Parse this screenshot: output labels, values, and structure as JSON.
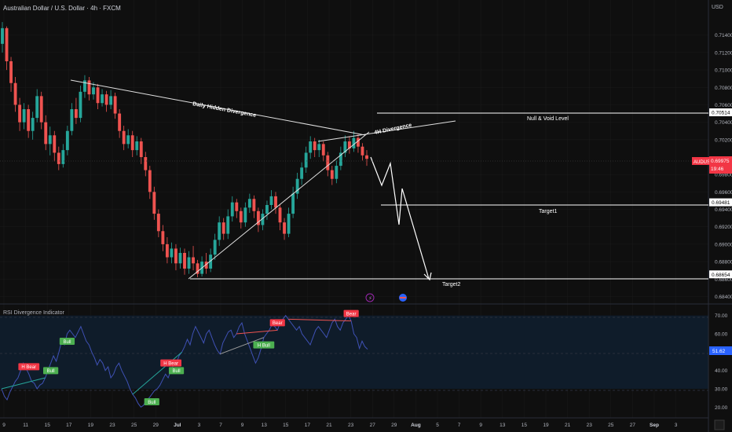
{
  "title": "Australian Dollar / U.S. Dollar · 4h · FXCM",
  "currency_label": "USD",
  "colors": {
    "background": "#0f0f0f",
    "bull": "#26a69a",
    "bear": "#ef5350",
    "grid": "#1c1c1c",
    "text": "#d1d4dc",
    "rsi_line": "#3f51b5",
    "rsi_band": "#0f1c2a",
    "annotation": "#ffffff",
    "price_tag": "#f23645"
  },
  "chart_data": [
    {
      "type": "candlestick",
      "title": "Australian Dollar / U.S. Dollar · 4h · FXCM",
      "ylim": [
        0.6835,
        0.7165
      ],
      "y_ticks": [
        "0.71400",
        "0.71200",
        "0.71000",
        "0.70800",
        "0.70600",
        "0.70400",
        "0.70200",
        "0.69800",
        "0.69600",
        "0.69400",
        "0.69200",
        "0.69000",
        "0.68800",
        "0.68600",
        "0.68400"
      ],
      "x_ticks": [
        "9",
        "11",
        "15",
        "17",
        "19",
        "23",
        "25",
        "29",
        "Jul",
        "3",
        "7",
        "9",
        "13",
        "15",
        "17",
        "21",
        "23",
        "27",
        "29",
        "Aug",
        "5",
        "7",
        "9",
        "13",
        "15",
        "19",
        "21",
        "23",
        "25",
        "27",
        "Sep",
        "3"
      ],
      "candles": [
        {
          "o": 0.713,
          "c": 0.7148,
          "h": 0.7155,
          "l": 0.712
        },
        {
          "o": 0.7148,
          "c": 0.711,
          "h": 0.715,
          "l": 0.71
        },
        {
          "o": 0.711,
          "c": 0.7085,
          "h": 0.7115,
          "l": 0.7075
        },
        {
          "o": 0.7085,
          "c": 0.706,
          "h": 0.7092,
          "l": 0.7052
        },
        {
          "o": 0.706,
          "c": 0.704,
          "h": 0.7068,
          "l": 0.703
        },
        {
          "o": 0.704,
          "c": 0.7055,
          "h": 0.7062,
          "l": 0.7032
        },
        {
          "o": 0.7055,
          "c": 0.703,
          "h": 0.706,
          "l": 0.7022
        },
        {
          "o": 0.703,
          "c": 0.7045,
          "h": 0.7052,
          "l": 0.702
        },
        {
          "o": 0.7045,
          "c": 0.707,
          "h": 0.7078,
          "l": 0.704
        },
        {
          "o": 0.707,
          "c": 0.704,
          "h": 0.7075,
          "l": 0.7032
        },
        {
          "o": 0.704,
          "c": 0.7015,
          "h": 0.7048,
          "l": 0.7008
        },
        {
          "o": 0.7015,
          "c": 0.7025,
          "h": 0.7035,
          "l": 0.7002
        },
        {
          "o": 0.7025,
          "c": 0.7005,
          "h": 0.703,
          "l": 0.6995
        },
        {
          "o": 0.7005,
          "c": 0.6992,
          "h": 0.7012,
          "l": 0.6985
        },
        {
          "o": 0.6992,
          "c": 0.7008,
          "h": 0.7015,
          "l": 0.6988
        },
        {
          "o": 0.7008,
          "c": 0.703,
          "h": 0.7036,
          "l": 0.7002
        },
        {
          "o": 0.703,
          "c": 0.7055,
          "h": 0.7062,
          "l": 0.7025
        },
        {
          "o": 0.7055,
          "c": 0.7045,
          "h": 0.7068,
          "l": 0.7038
        },
        {
          "o": 0.7045,
          "c": 0.7075,
          "h": 0.7082,
          "l": 0.704
        },
        {
          "o": 0.7075,
          "c": 0.7088,
          "h": 0.7094,
          "l": 0.7068
        },
        {
          "o": 0.7088,
          "c": 0.7072,
          "h": 0.7092,
          "l": 0.7065
        },
        {
          "o": 0.7072,
          "c": 0.708,
          "h": 0.7086,
          "l": 0.7066
        },
        {
          "o": 0.708,
          "c": 0.7062,
          "h": 0.7084,
          "l": 0.7055
        },
        {
          "o": 0.7062,
          "c": 0.7072,
          "h": 0.7078,
          "l": 0.7058
        },
        {
          "o": 0.7072,
          "c": 0.706,
          "h": 0.7076,
          "l": 0.7052
        },
        {
          "o": 0.706,
          "c": 0.707,
          "h": 0.7077,
          "l": 0.7055
        },
        {
          "o": 0.707,
          "c": 0.705,
          "h": 0.7074,
          "l": 0.7044
        },
        {
          "o": 0.705,
          "c": 0.703,
          "h": 0.7055,
          "l": 0.7022
        },
        {
          "o": 0.703,
          "c": 0.7015,
          "h": 0.7036,
          "l": 0.7008
        },
        {
          "o": 0.7015,
          "c": 0.7025,
          "h": 0.7032,
          "l": 0.701
        },
        {
          "o": 0.7025,
          "c": 0.7008,
          "h": 0.703,
          "l": 0.7
        },
        {
          "o": 0.7008,
          "c": 0.7018,
          "h": 0.7024,
          "l": 0.7002
        },
        {
          "o": 0.7018,
          "c": 0.7,
          "h": 0.7022,
          "l": 0.6992
        },
        {
          "o": 0.7,
          "c": 0.6985,
          "h": 0.7006,
          "l": 0.6978
        },
        {
          "o": 0.6985,
          "c": 0.696,
          "h": 0.699,
          "l": 0.6952
        },
        {
          "o": 0.696,
          "c": 0.6935,
          "h": 0.6966,
          "l": 0.6928
        },
        {
          "o": 0.6935,
          "c": 0.6915,
          "h": 0.694,
          "l": 0.6908
        },
        {
          "o": 0.6915,
          "c": 0.69,
          "h": 0.6922,
          "l": 0.6892
        },
        {
          "o": 0.69,
          "c": 0.6885,
          "h": 0.6908,
          "l": 0.6878
        },
        {
          "o": 0.6885,
          "c": 0.6895,
          "h": 0.6902,
          "l": 0.6878
        },
        {
          "o": 0.6895,
          "c": 0.6878,
          "h": 0.69,
          "l": 0.687
        },
        {
          "o": 0.6878,
          "c": 0.689,
          "h": 0.6896,
          "l": 0.6872
        },
        {
          "o": 0.689,
          "c": 0.6872,
          "h": 0.6895,
          "l": 0.6865
        },
        {
          "o": 0.6872,
          "c": 0.6885,
          "h": 0.6892,
          "l": 0.6866
        },
        {
          "o": 0.6885,
          "c": 0.6878,
          "h": 0.6898,
          "l": 0.687
        },
        {
          "o": 0.6878,
          "c": 0.6866,
          "h": 0.6882,
          "l": 0.6862
        },
        {
          "o": 0.6866,
          "c": 0.688,
          "h": 0.6886,
          "l": 0.6863
        },
        {
          "o": 0.688,
          "c": 0.6872,
          "h": 0.689,
          "l": 0.6866
        },
        {
          "o": 0.6872,
          "c": 0.6888,
          "h": 0.6895,
          "l": 0.6868
        },
        {
          "o": 0.6888,
          "c": 0.6905,
          "h": 0.6912,
          "l": 0.6882
        },
        {
          "o": 0.6905,
          "c": 0.6925,
          "h": 0.6932,
          "l": 0.6898
        },
        {
          "o": 0.6925,
          "c": 0.6912,
          "h": 0.693,
          "l": 0.6905
        },
        {
          "o": 0.6912,
          "c": 0.6932,
          "h": 0.694,
          "l": 0.6906
        },
        {
          "o": 0.6932,
          "c": 0.6948,
          "h": 0.6955,
          "l": 0.6926
        },
        {
          "o": 0.6948,
          "c": 0.6938,
          "h": 0.6952,
          "l": 0.693
        },
        {
          "o": 0.6938,
          "c": 0.6925,
          "h": 0.6942,
          "l": 0.6918
        },
        {
          "o": 0.6925,
          "c": 0.6942,
          "h": 0.6948,
          "l": 0.692
        },
        {
          "o": 0.6942,
          "c": 0.6952,
          "h": 0.6958,
          "l": 0.6936
        },
        {
          "o": 0.6952,
          "c": 0.6938,
          "h": 0.6956,
          "l": 0.693
        },
        {
          "o": 0.6938,
          "c": 0.6922,
          "h": 0.6942,
          "l": 0.6914
        },
        {
          "o": 0.6922,
          "c": 0.6935,
          "h": 0.694,
          "l": 0.6916
        },
        {
          "o": 0.6935,
          "c": 0.6945,
          "h": 0.695,
          "l": 0.6928
        },
        {
          "o": 0.6945,
          "c": 0.6955,
          "h": 0.6962,
          "l": 0.694
        },
        {
          "o": 0.6955,
          "c": 0.6942,
          "h": 0.696,
          "l": 0.6935
        },
        {
          "o": 0.6942,
          "c": 0.6925,
          "h": 0.6946,
          "l": 0.6916
        },
        {
          "o": 0.6925,
          "c": 0.6912,
          "h": 0.693,
          "l": 0.6905
        },
        {
          "o": 0.6912,
          "c": 0.6935,
          "h": 0.6942,
          "l": 0.6908
        },
        {
          "o": 0.6935,
          "c": 0.6958,
          "h": 0.6966,
          "l": 0.693
        },
        {
          "o": 0.6958,
          "c": 0.6975,
          "h": 0.6982,
          "l": 0.6952
        },
        {
          "o": 0.6975,
          "c": 0.6988,
          "h": 0.6994,
          "l": 0.6968
        },
        {
          "o": 0.6988,
          "c": 0.7005,
          "h": 0.7012,
          "l": 0.6982
        },
        {
          "o": 0.7005,
          "c": 0.7018,
          "h": 0.7024,
          "l": 0.6998
        },
        {
          "o": 0.7018,
          "c": 0.7008,
          "h": 0.7022,
          "l": 0.7
        },
        {
          "o": 0.7008,
          "c": 0.7015,
          "h": 0.702,
          "l": 0.7
        },
        {
          "o": 0.7015,
          "c": 0.7002,
          "h": 0.7018,
          "l": 0.6995
        },
        {
          "o": 0.7002,
          "c": 0.6985,
          "h": 0.7006,
          "l": 0.6978
        },
        {
          "o": 0.6985,
          "c": 0.6975,
          "h": 0.699,
          "l": 0.6968
        },
        {
          "o": 0.6975,
          "c": 0.699,
          "h": 0.6996,
          "l": 0.697
        },
        {
          "o": 0.699,
          "c": 0.7005,
          "h": 0.7012,
          "l": 0.6985
        },
        {
          "o": 0.7005,
          "c": 0.7018,
          "h": 0.7025,
          "l": 0.7
        },
        {
          "o": 0.7018,
          "c": 0.701,
          "h": 0.7024,
          "l": 0.7004
        },
        {
          "o": 0.701,
          "c": 0.7022,
          "h": 0.703,
          "l": 0.7006
        },
        {
          "o": 0.7022,
          "c": 0.7012,
          "h": 0.7026,
          "l": 0.7005
        },
        {
          "o": 0.7012,
          "c": 0.7002,
          "h": 0.7016,
          "l": 0.6996
        },
        {
          "o": 0.7002,
          "c": 0.6998,
          "h": 0.7008,
          "l": 0.699
        }
      ]
    },
    {
      "type": "line",
      "title": "RSI Divergence Indicator",
      "ylim": [
        15,
        75
      ],
      "y_ticks": [
        "70.00",
        "60.00",
        "40.00",
        "30.00",
        "20.00"
      ],
      "current_value_label": "51.62",
      "band": [
        30,
        70
      ],
      "midline": 50,
      "values": [
        30,
        26,
        24,
        28,
        31,
        34,
        36,
        40,
        44,
        41,
        38,
        34,
        33,
        30,
        32,
        33,
        36,
        40,
        44,
        48,
        45,
        50,
        56,
        54,
        60,
        62,
        60,
        58,
        61,
        64,
        60,
        56,
        54,
        50,
        47,
        43,
        46,
        44,
        40,
        42,
        36,
        38,
        42,
        44,
        40,
        37,
        34,
        30,
        27,
        25,
        22,
        20,
        21,
        24,
        25,
        27,
        29,
        30,
        32,
        35,
        38,
        36,
        40,
        43,
        44,
        48,
        50,
        53,
        57,
        54,
        60,
        64,
        61,
        58,
        55,
        60,
        62,
        58,
        54,
        51,
        49,
        55,
        58,
        61,
        62,
        58,
        60,
        64,
        66,
        60,
        56,
        52,
        48,
        44,
        47,
        52,
        58,
        60,
        62,
        65,
        64,
        62,
        66,
        68,
        70,
        68,
        66,
        64,
        62,
        64,
        60,
        58,
        56,
        54,
        58,
        62,
        64,
        62,
        60,
        58,
        62,
        66,
        68,
        64,
        62,
        66,
        68,
        70,
        67,
        60,
        58,
        52,
        56,
        53,
        51.62
      ],
      "labels": [
        {
          "text": "H Bear"
        },
        {
          "text": "Bull"
        },
        {
          "text": "Bull"
        },
        {
          "text": "H Bear"
        },
        {
          "text": "Bull"
        },
        {
          "text": "Bull"
        },
        {
          "text": "Bear"
        },
        {
          "text": "H Bull"
        },
        {
          "text": "Bear"
        }
      ]
    }
  ],
  "levels": [
    {
      "name": "Null & Void Level",
      "price": 0.70514,
      "tag": "0.70514"
    },
    {
      "name": "Target1",
      "price": 0.69481,
      "tag": "0.69481"
    },
    {
      "name": "Target2",
      "price": 0.68654,
      "tag": "0.68654"
    }
  ],
  "annotations": {
    "daily_divergence": "Daily Hidden Divergence",
    "h4_divergence": "4H Divergence"
  },
  "current_price": {
    "symbol": "AUDUSD",
    "price": "0.69975",
    "value": 0.69975,
    "countdown": "19:46"
  },
  "icons": [
    "lightning-icon",
    "flag-icon"
  ]
}
